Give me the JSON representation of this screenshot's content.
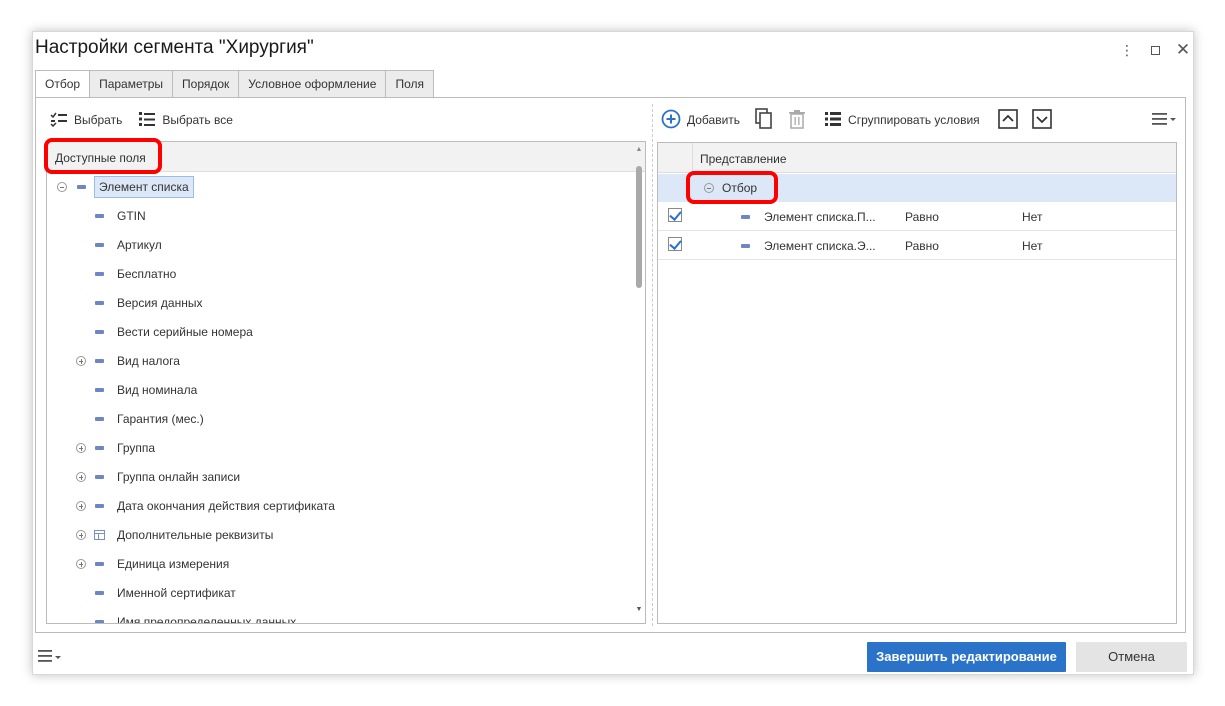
{
  "window": {
    "title": "Настройки сегмента \"Хирургия\""
  },
  "tabs": [
    {
      "label": "Отбор",
      "active": true
    },
    {
      "label": "Параметры"
    },
    {
      "label": "Порядок"
    },
    {
      "label": "Условное оформление"
    },
    {
      "label": "Поля"
    }
  ],
  "left": {
    "toolbar": {
      "select_label": "Выбрать",
      "select_all_label": "Выбрать все"
    },
    "header": "Доступные поля",
    "items": [
      {
        "label": "Элемент списка",
        "expander": "minus",
        "icon": "dash",
        "level": 0
      },
      {
        "label": "GTIN",
        "icon": "dash",
        "level": 1
      },
      {
        "label": "Артикул",
        "icon": "dash",
        "level": 1
      },
      {
        "label": "Бесплатно",
        "icon": "dash",
        "level": 1
      },
      {
        "label": "Версия данных",
        "icon": "dash",
        "level": 1
      },
      {
        "label": "Вести серийные номера",
        "icon": "dash",
        "level": 1
      },
      {
        "label": "Вид налога",
        "expander": "plus",
        "icon": "dash",
        "level": 1
      },
      {
        "label": "Вид номинала",
        "icon": "dash",
        "level": 1
      },
      {
        "label": "Гарантия (мес.)",
        "icon": "dash",
        "level": 1
      },
      {
        "label": "Группа",
        "expander": "plus",
        "icon": "dash",
        "level": 1
      },
      {
        "label": "Группа онлайн записи",
        "expander": "plus",
        "icon": "dash",
        "level": 1
      },
      {
        "label": "Дата окончания действия сертификата",
        "expander": "plus",
        "icon": "dash",
        "level": 1
      },
      {
        "label": "Дополнительные реквизиты",
        "expander": "plus",
        "icon": "table",
        "level": 1
      },
      {
        "label": "Единица измерения",
        "expander": "plus",
        "icon": "dash",
        "level": 1
      },
      {
        "label": "Именной сертификат",
        "icon": "dash",
        "level": 1
      },
      {
        "label": "Имя предопределенных данных",
        "icon": "dash",
        "level": 1
      }
    ]
  },
  "right": {
    "toolbar": {
      "add_label": "Добавить",
      "group_label": "Сгруппировать условия"
    },
    "header": "Представление",
    "group": "Отбор",
    "conditions": [
      {
        "field": "Элемент списка.П...",
        "op": "Равно",
        "value": "Нет",
        "checked": true
      },
      {
        "field": "Элемент списка.Э...",
        "op": "Равно",
        "value": "Нет",
        "checked": true
      }
    ]
  },
  "footer": {
    "finish_label": "Завершить редактирование",
    "cancel_label": "Отмена"
  },
  "colors": {
    "accent": "#2b73c8",
    "highlight": "#ff0000",
    "selection": "#dce8f8"
  }
}
